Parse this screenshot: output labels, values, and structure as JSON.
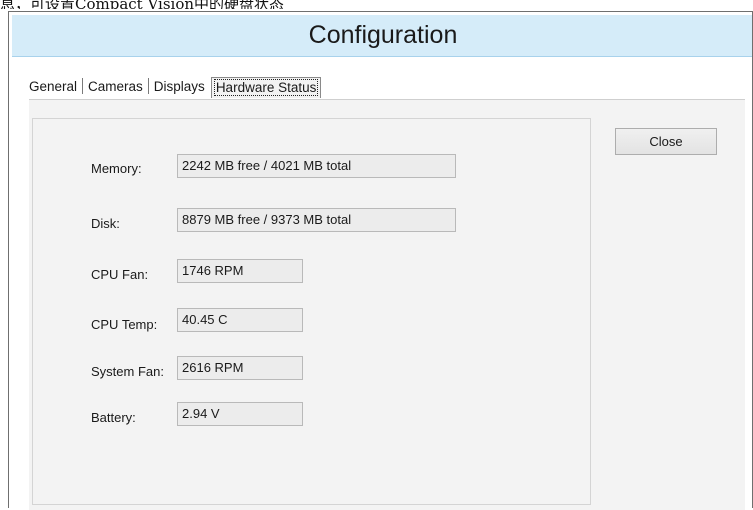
{
  "caption": "息，可设置Compact Vision中的硬盘状态",
  "window": {
    "title": "Configuration"
  },
  "tabs": [
    {
      "label": "General",
      "active": false
    },
    {
      "label": "Cameras",
      "active": false
    },
    {
      "label": "Displays",
      "active": false
    },
    {
      "label": "Hardware Status",
      "active": true
    }
  ],
  "hardware_status": {
    "memory": {
      "label": "Memory:",
      "value": "2242 MB free / 4021 MB total"
    },
    "disk": {
      "label": "Disk:",
      "value": "8879 MB free / 9373 MB total"
    },
    "cpu_fan": {
      "label": "CPU Fan:",
      "value": "1746 RPM"
    },
    "cpu_temp": {
      "label": "CPU Temp:",
      "value": "40.45 C"
    },
    "system_fan": {
      "label": "System Fan:",
      "value": "2616 RPM"
    },
    "battery": {
      "label": "Battery:",
      "value": "2.94 V"
    }
  },
  "buttons": {
    "close_label": "Close"
  },
  "colors": {
    "title_bar": "#d5ecf9",
    "panel_background": "#f3f3f3",
    "field_background": "#ececec"
  }
}
